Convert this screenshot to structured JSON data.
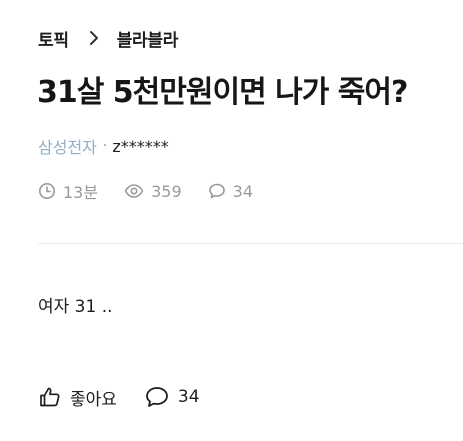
{
  "breadcrumb": {
    "topic_label": "토픽",
    "board_label": "블라블라"
  },
  "post": {
    "title": "31살 5천만원이면 나가 죽어?",
    "company": "삼성전자",
    "separator": "·",
    "nickname": "z******",
    "time_ago": "13분",
    "views": "359",
    "comments": "34",
    "body": "여자 31 .."
  },
  "actions": {
    "like_label": "좋아요",
    "comment_count": "34"
  },
  "icons": {
    "chevron": "chevron-right-icon",
    "clock": "clock-icon",
    "eye": "eye-icon",
    "comment": "comment-bubble-icon",
    "thumb": "thumbs-up-icon"
  },
  "colors": {
    "company": "#8fb0c8",
    "meta": "#9a9a9a",
    "text": "#1e1e1e"
  }
}
